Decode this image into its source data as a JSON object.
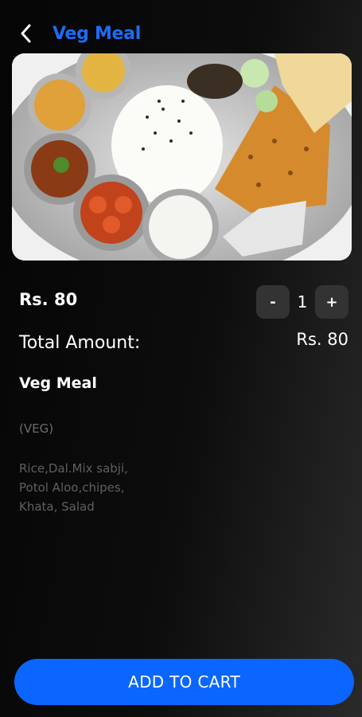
{
  "header": {
    "back_icon": "chevron-left-icon",
    "title": "Veg Meal"
  },
  "colors": {
    "accent": "#1e6cf5",
    "button": "#0a66ff",
    "qty_button_bg": "#333333"
  },
  "product": {
    "price": "Rs. 80",
    "quantity": "1",
    "decrement_label": "-",
    "increment_label": "+",
    "total_label": "Total Amount:",
    "total_value": "Rs. 80",
    "name": "Veg Meal",
    "type": "(VEG)",
    "description_lines": [
      "Rice,Dal.Mix sabji,",
      "Potol Aloo,chipes,",
      "Khata, Salad"
    ]
  },
  "actions": {
    "add_to_cart": "ADD TO CART"
  }
}
